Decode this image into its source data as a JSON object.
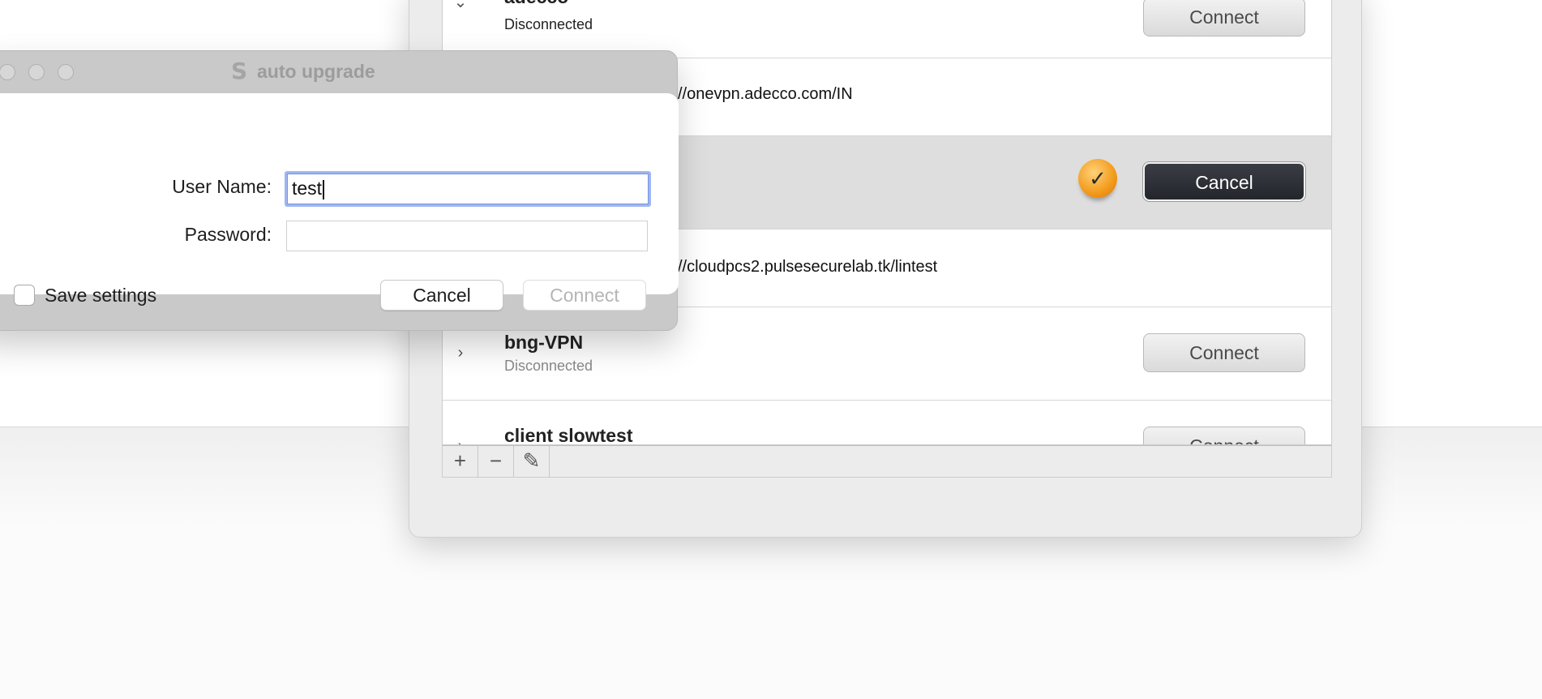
{
  "vpn_list": {
    "rows": [
      {
        "name": "adecco",
        "status": "Disconnected",
        "button": "Connect"
      },
      {
        "url": "//onevpn.adecco.com/IN"
      },
      {
        "button": "Cancel"
      },
      {
        "url": "//cloudpcs2.pulsesecurelab.tk/lintest"
      },
      {
        "name": "bng-VPN",
        "status": "Disconnected",
        "button": "Connect"
      },
      {
        "name": "client slowtest",
        "button": "Connect"
      }
    ]
  },
  "toolbar": {
    "add": "+",
    "remove": "−",
    "edit": "✎"
  },
  "dialog": {
    "title": "auto upgrade",
    "username_label": "User Name:",
    "username_value": "test",
    "password_label": "Password:",
    "password_value": "",
    "save_settings_label": "Save settings",
    "save_settings_checked": false,
    "cancel_label": "Cancel",
    "connect_label": "Connect"
  },
  "colors": {
    "focus_ring": "#9fb6f0",
    "primary_dark": "#2b2e34",
    "status_icon": "#f29a1a"
  }
}
